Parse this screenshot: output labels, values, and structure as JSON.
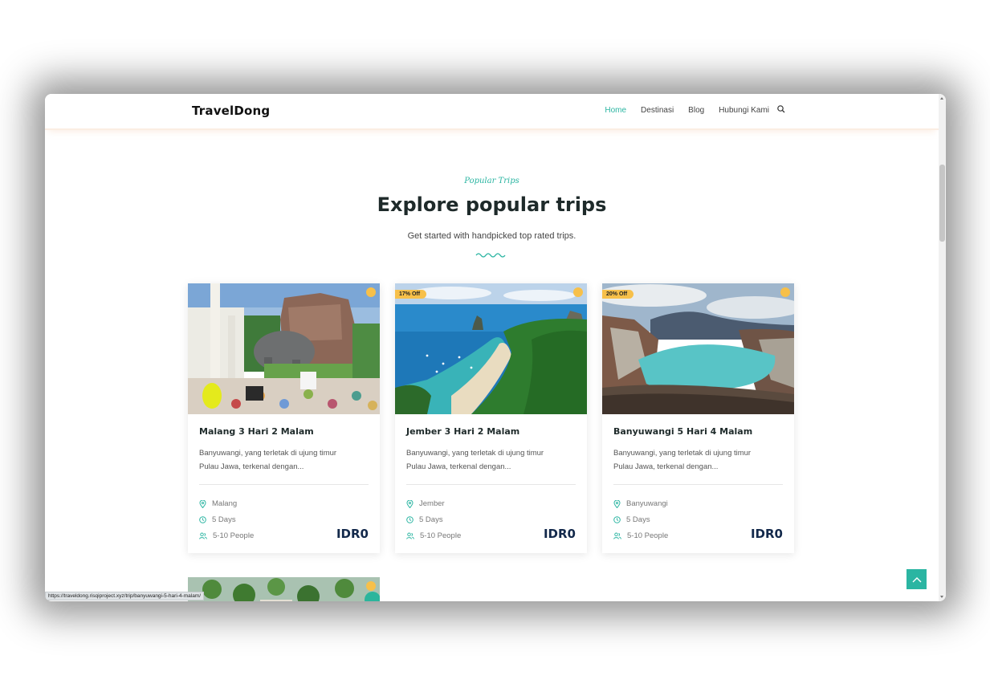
{
  "brand": {
    "logo": "TravelDong",
    "accent_color": "#2bb5a2",
    "badge_color": "#f7c04a"
  },
  "nav": {
    "items": [
      {
        "label": "Home",
        "active": true
      },
      {
        "label": "Destinasi",
        "active": false
      },
      {
        "label": "Blog",
        "active": false
      },
      {
        "label": "Hubungi Kami",
        "active": false
      }
    ],
    "search_icon": "search-icon"
  },
  "section": {
    "subtitle": "Popular Trips",
    "title": "Explore popular trips",
    "description": "Get started with handpicked top rated trips."
  },
  "trips": [
    {
      "title": "Malang 3 Hari 2 Malam",
      "badge": "",
      "desc_line1": "Banyuwangi, yang terletak di ujung timur",
      "desc_line2": "Pulau Jawa, terkenal dengan...",
      "location": "Malang",
      "duration": "5 Days",
      "people": "5-10 People",
      "price": "IDR0"
    },
    {
      "title": "Jember 3 Hari 2 Malam",
      "badge": "17% Off",
      "desc_line1": "Banyuwangi, yang terletak di ujung timur",
      "desc_line2": "Pulau Jawa, terkenal dengan...",
      "location": "Jember",
      "duration": "5 Days",
      "people": "5-10 People",
      "price": "IDR0"
    },
    {
      "title": "Banyuwangi 5 Hari 4 Malam",
      "badge": "20% Off",
      "desc_line1": "Banyuwangi, yang terletak di ujung timur",
      "desc_line2": "Pulau Jawa, terkenal dengan...",
      "location": "Banyuwangi",
      "duration": "5 Days",
      "people": "5-10 People",
      "price": "IDR0"
    }
  ],
  "status_bar": {
    "url": "https://traveldong.risqiproject.xyz/trip/banyuwangi-5-hari-4-malam/"
  }
}
